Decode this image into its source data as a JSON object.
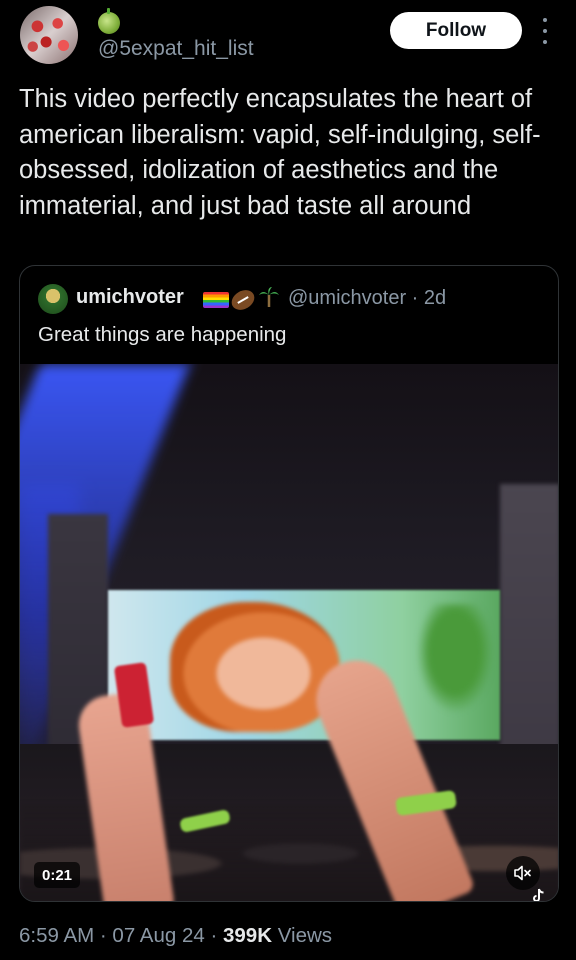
{
  "author": {
    "handle": "@5expat_hit_list",
    "emoji_icon": "green-apple-icon"
  },
  "follow_label": "Follow",
  "tweet": {
    "text": "This video perfectly encapsulates the heart of american liberalism: vapid, self-indulging, self-obsessed, idolization of aesthetics and the immaterial, and just bad taste all around"
  },
  "quote": {
    "name": "umichvoter",
    "name_icons": [
      "rainbow-flag-icon",
      "football-icon",
      "palm-tree-icon"
    ],
    "handle_time": "@umichvoter · 2d",
    "text": "Great things are happening",
    "video": {
      "duration": "0:21",
      "muted": true
    }
  },
  "meta": {
    "time_date": "6:59 AM · 07 Aug 24 · ",
    "views_count": "399K",
    "views_label": " Views"
  },
  "colors": {
    "background": "#000000",
    "primary_text": "#e7e9ea",
    "secondary_text": "#8b98a5",
    "border": "#2f3336",
    "follow_bg": "#ffffff"
  }
}
